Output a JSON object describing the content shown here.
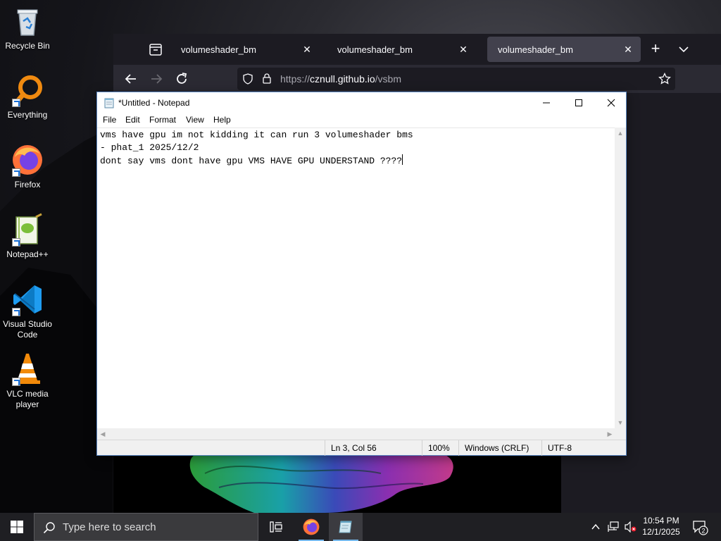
{
  "desktop": {
    "icons": [
      {
        "label": "Recycle Bin",
        "icon": "recycle-bin-icon"
      },
      {
        "label": "Everything",
        "icon": "everything-search-icon"
      },
      {
        "label": "Firefox",
        "icon": "firefox-icon"
      },
      {
        "label": "Notepad++",
        "icon": "notepad-plus-plus-icon"
      },
      {
        "label": "Visual Studio Code",
        "icon": "vscode-icon"
      },
      {
        "label": "VLC media player",
        "icon": "vlc-icon"
      }
    ]
  },
  "browser": {
    "tabs": [
      {
        "title": "volumeshader_bm",
        "active": false
      },
      {
        "title": "volumeshader_bm",
        "active": false
      },
      {
        "title": "volumeshader_bm",
        "active": true
      }
    ],
    "url": {
      "scheme": "https://",
      "host": "cznull.github.io",
      "path": "/vsbm"
    }
  },
  "notepad": {
    "title": "*Untitled - Notepad",
    "menu": [
      "File",
      "Edit",
      "Format",
      "View",
      "Help"
    ],
    "lines": [
      "vms have gpu im not kidding it can run 3 volumeshader bms",
      "- phat_1 2025/12/2",
      "dont say vms dont have gpu VMS HAVE GPU UNDERSTAND ????"
    ],
    "status": {
      "position": "Ln 3, Col 56",
      "zoom": "100%",
      "line_ending": "Windows (CRLF)",
      "encoding": "UTF-8"
    }
  },
  "taskbar": {
    "search_placeholder": "Type here to search",
    "time": "10:54 PM",
    "date": "12/1/2025",
    "notification_count": "2"
  },
  "colors": {
    "firefox_dark": "#1c1b22",
    "firefox_tab_active": "#42414d",
    "taskbar": "#1f1f23",
    "accent": "#76b9ed"
  }
}
